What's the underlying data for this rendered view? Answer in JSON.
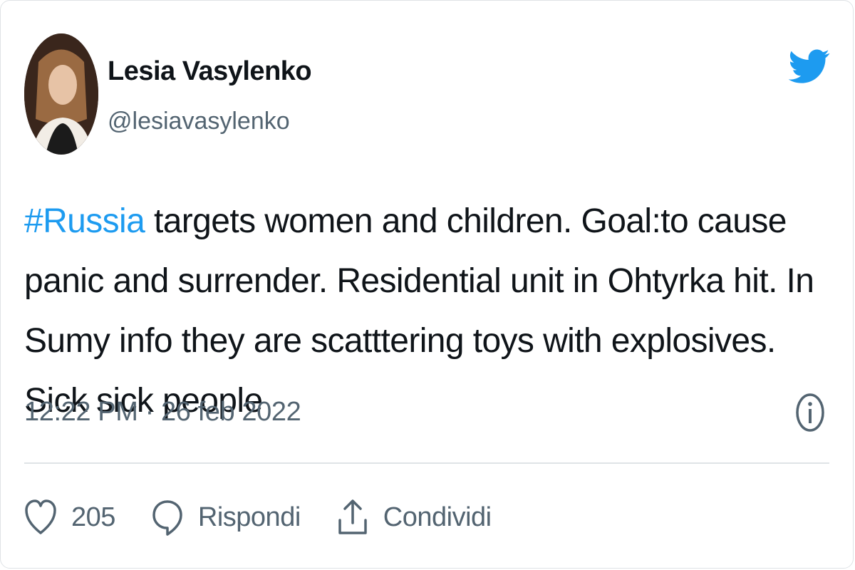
{
  "tweet": {
    "author_name": "Lesia Vasylenko",
    "author_handle": "@lesiavasylenko",
    "hashtag": "#Russia",
    "text_rest": " targets women and children. Goal:to cause panic and surrender. Residential unit in Ohtyrka hit. In Sumy info they are scatttering toys with explosives. Sick sick people",
    "timestamp": "12:22 PM · 26 feb 2022"
  },
  "actions": {
    "like_count": "205",
    "reply_label": "Rispondi",
    "share_label": "Condividi"
  },
  "icons": {
    "brand": "twitter-bird-icon",
    "info": "info-icon",
    "like": "heart-icon",
    "reply": "speech-bubble-icon",
    "share": "share-upload-icon"
  },
  "colors": {
    "accent": "#1d9bf0",
    "text": "#0f1419",
    "muted": "#536471",
    "border": "#dfe3e6"
  }
}
